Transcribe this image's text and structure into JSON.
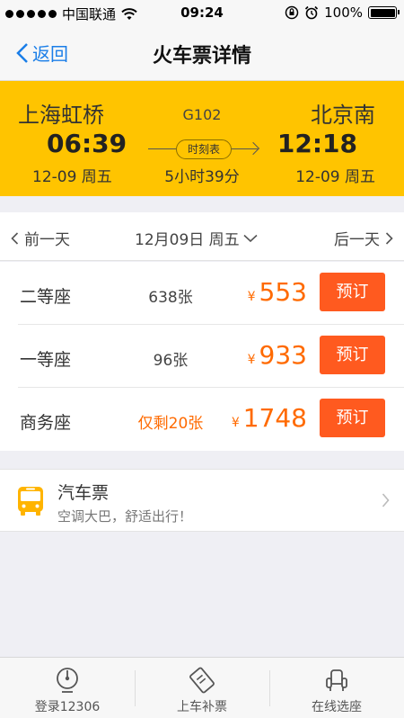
{
  "status_bar": {
    "carrier": "中国联通",
    "time": "09:24",
    "battery": "100%",
    "battery_level": 1.0
  },
  "nav": {
    "back_label": "返回",
    "title": "火车票详情"
  },
  "train": {
    "from_station": "上海虹桥",
    "to_station": "北京南",
    "depart_time": "06:39",
    "arrive_time": "12:18",
    "depart_date": "12-09 周五",
    "arrive_date": "12-09 周五",
    "train_no": "G102",
    "timetable_label": "时刻表",
    "duration": "5小时39分",
    "bg_color": "#ffc400"
  },
  "date_bar": {
    "prev_label": "前一天",
    "current_label": "12月09日 周五",
    "next_label": "后一天"
  },
  "seats": [
    {
      "name": "二等座",
      "count": "638张",
      "count_warn": false,
      "currency": "¥",
      "price": "553",
      "book_label": "预订"
    },
    {
      "name": "一等座",
      "count": "96张",
      "count_warn": false,
      "currency": "¥",
      "price": "933",
      "book_label": "预订"
    },
    {
      "name": "商务座",
      "count": "仅剩20张",
      "count_warn": true,
      "currency": "¥",
      "price": "1748",
      "book_label": "预订"
    }
  ],
  "bus": {
    "title": "汽车票",
    "subtitle": "空调大巴，舒适出行！",
    "icon": "bus-icon"
  },
  "tabs": [
    {
      "label": "登录12306",
      "icon": "login-icon"
    },
    {
      "label": "上车补票",
      "icon": "ticket-icon"
    },
    {
      "label": "在线选座",
      "icon": "seat-icon"
    }
  ],
  "colors": {
    "accent_blue": "#1a7ee8",
    "price_orange": "#ff6a00",
    "book_button": "#ff5a1f",
    "header_yellow": "#ffc400"
  }
}
